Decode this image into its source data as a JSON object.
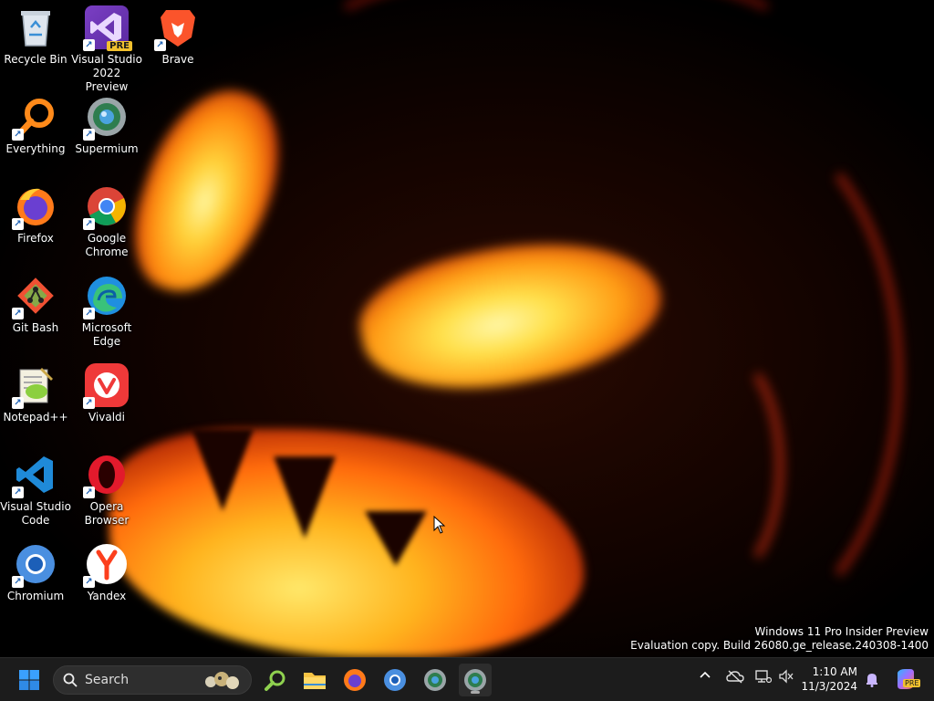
{
  "desktop": {
    "icons": [
      {
        "label": "Recycle Bin",
        "name": "recycle-bin"
      },
      {
        "label": "Visual Studio 2022 Preview",
        "name": "visual-studio-2022-preview",
        "badge": "PRE"
      },
      {
        "label": "Brave",
        "name": "brave"
      },
      {
        "label": "Everything",
        "name": "everything"
      },
      {
        "label": "Supermium",
        "name": "supermium"
      },
      {
        "label": "Firefox",
        "name": "firefox"
      },
      {
        "label": "Google Chrome",
        "name": "google-chrome"
      },
      {
        "label": "Git Bash",
        "name": "git-bash"
      },
      {
        "label": "Microsoft Edge",
        "name": "microsoft-edge"
      },
      {
        "label": "Notepad++",
        "name": "notepad-plus-plus"
      },
      {
        "label": "Vivaldi",
        "name": "vivaldi"
      },
      {
        "label": "Visual Studio Code",
        "name": "visual-studio-code"
      },
      {
        "label": "Opera Browser",
        "name": "opera-browser"
      },
      {
        "label": "Chromium",
        "name": "chromium"
      },
      {
        "label": "Yandex",
        "name": "yandex"
      }
    ]
  },
  "watermark": {
    "line1": "Windows 11 Pro Insider Preview",
    "line2": "Evaluation copy. Build 26080.ge_release.240308-1400"
  },
  "taskbar": {
    "search_label": "Search",
    "pinned": [
      "start-icon",
      "everything-icon",
      "file-explorer-icon",
      "firefox-icon",
      "chromium-icon",
      "supermium-icon",
      "supermium-active-icon"
    ],
    "clock": {
      "time": "1:10 AM",
      "date": "11/3/2024"
    },
    "copilot_badge": "PRE"
  },
  "colors": {
    "taskbar_bg": "#1c1c1c",
    "accent": "#0a84ff"
  }
}
